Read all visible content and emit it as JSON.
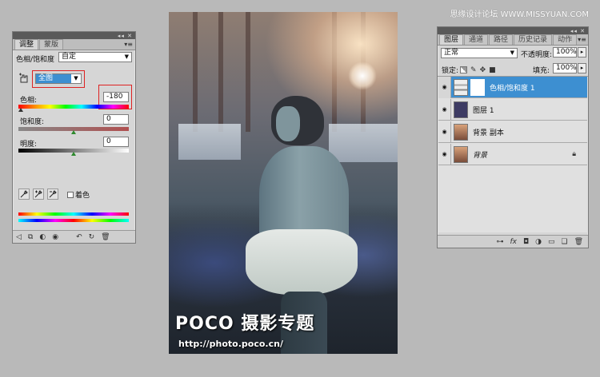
{
  "watermark": "思缘设计论坛 WWW.MISSYUAN.COM",
  "photo": {
    "brand": "POCO 摄影专题",
    "url": "http://photo.poco.cn/"
  },
  "adjust_panel": {
    "strip": "◂◂ ✕",
    "tabs": [
      "调整",
      "蒙版"
    ],
    "menu_icon": "▾≡",
    "preset_label": "色相/饱和度",
    "preset_value": "自定",
    "channel_value": "全图",
    "hue_label": "色相:",
    "hue_value": "-180",
    "saturation_label": "饱和度:",
    "saturation_value": "0",
    "lightness_label": "明度:",
    "lightness_value": "0",
    "colorize_label": "着色",
    "icons": [
      "hand-adjust-icon",
      "eyedropper-icon",
      "eyedropper-plus-icon",
      "eyedropper-minus-icon"
    ]
  },
  "layers_panel": {
    "strip": "◂◂ ✕",
    "tabs": [
      "图层",
      "通道",
      "路径",
      "历史记录",
      "动作"
    ],
    "menu_icon": "▾≡",
    "blend_mode": "正常",
    "opacity_label": "不透明度:",
    "opacity_value": "100%",
    "lock_label": "锁定:",
    "fill_label": "填充:",
    "fill_value": "100%",
    "layers": [
      {
        "name": "色相/饱和度 1",
        "selected": true
      },
      {
        "name": "图层 1",
        "selected": false
      },
      {
        "name": "背景 副本",
        "selected": false
      },
      {
        "name": "背景",
        "selected": false
      }
    ]
  },
  "colors": {
    "selected_layer": "#3d8fd1",
    "red_highlight": "#dd2222",
    "panel_bg": "#d6d6d6"
  }
}
